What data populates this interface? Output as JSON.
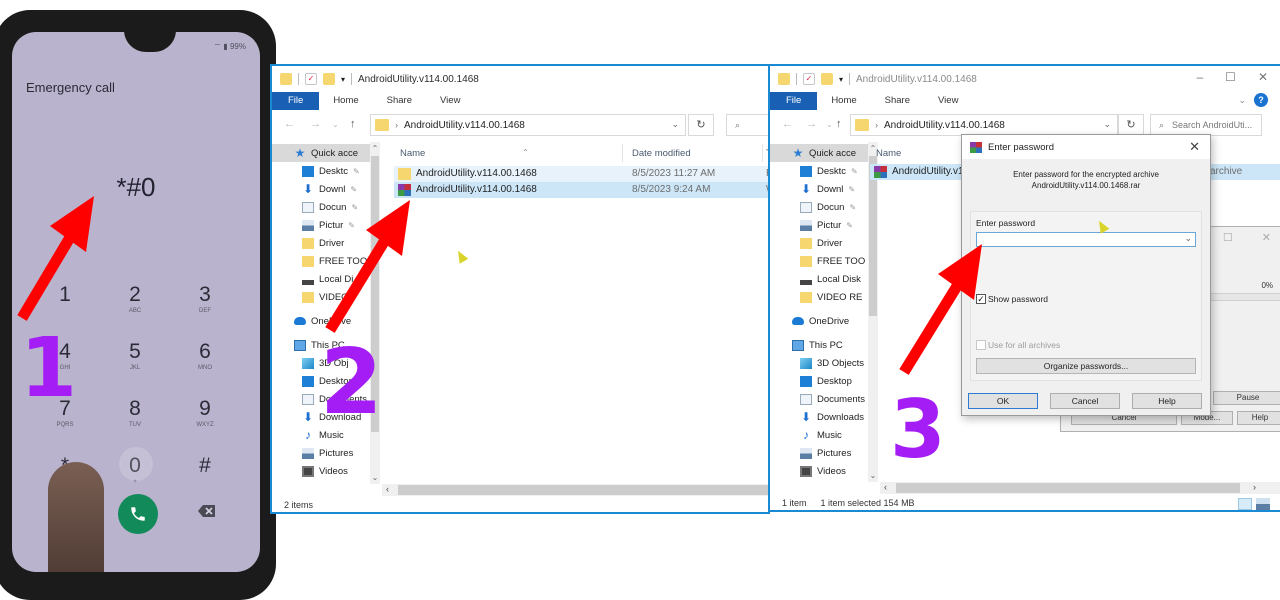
{
  "phone": {
    "status_text": "99%",
    "emergency_label": "Emergency call",
    "dialed_code": "*#0",
    "keys": [
      {
        "num": "1",
        "letters": ""
      },
      {
        "num": "2",
        "letters": "ABC"
      },
      {
        "num": "3",
        "letters": "DEF"
      },
      {
        "num": "4",
        "letters": "GHI"
      },
      {
        "num": "5",
        "letters": "JKL"
      },
      {
        "num": "6",
        "letters": "MNO"
      },
      {
        "num": "7",
        "letters": "PQRS"
      },
      {
        "num": "8",
        "letters": "TUV"
      },
      {
        "num": "9",
        "letters": "WXYZ"
      },
      {
        "num": "*",
        "letters": ""
      },
      {
        "num": "0",
        "letters": "+"
      },
      {
        "num": "#",
        "letters": ""
      }
    ],
    "call_icon": "phone-icon",
    "backspace_icon": "backspace-icon",
    "call_color": "#128a5a"
  },
  "explorer_step2": {
    "title": "AndroidUtility.v114.00.1468",
    "ribbon_tabs": [
      "File",
      "Home",
      "Share",
      "View"
    ],
    "address": "AndroidUtility.v114.00.1468",
    "columns": {
      "name": "Name",
      "date": "Date modified",
      "type": "T"
    },
    "sidebar": [
      {
        "label": "Quick acce",
        "icon": "star",
        "pinned": false
      },
      {
        "label": "Desktc",
        "icon": "desktop",
        "pinned": true
      },
      {
        "label": "Downl",
        "icon": "down",
        "pinned": true
      },
      {
        "label": "Docun",
        "icon": "doc",
        "pinned": true
      },
      {
        "label": "Pictur",
        "icon": "pic",
        "pinned": true
      },
      {
        "label": "Driver",
        "icon": "folder",
        "pinned": false
      },
      {
        "label": "FREE TOO",
        "icon": "folder",
        "pinned": false
      },
      {
        "label": "Local Di",
        "icon": "disk",
        "pinned": false
      },
      {
        "label": "VIDEO",
        "icon": "folder",
        "pinned": false
      },
      {
        "label": "OneDrive",
        "icon": "cloud",
        "pinned": false
      },
      {
        "label": "This PC",
        "icon": "pc",
        "pinned": false
      },
      {
        "label": "3D Obj",
        "icon": "obj",
        "pinned": false
      },
      {
        "label": "Desktop",
        "icon": "desktop",
        "pinned": false
      },
      {
        "label": "Documents",
        "icon": "doc",
        "pinned": false
      },
      {
        "label": "Download",
        "icon": "down",
        "pinned": false
      },
      {
        "label": "Music",
        "icon": "music",
        "pinned": false
      },
      {
        "label": "Pictures",
        "icon": "pic",
        "pinned": false
      },
      {
        "label": "Videos",
        "icon": "video",
        "pinned": false
      }
    ],
    "files": [
      {
        "name": "AndroidUtility.v114.00.1468",
        "date": "8/5/2023 11:27 AM",
        "type": "F",
        "icon": "folder"
      },
      {
        "name": "AndroidUtility.v114.00.1468",
        "date": "8/5/2023 9:24 AM",
        "type": "W",
        "icon": "rar"
      }
    ],
    "status": "2 items"
  },
  "explorer_step3": {
    "title": "AndroidUtility.v114.00.1468",
    "ribbon_tabs": [
      "File",
      "Home",
      "Share",
      "View"
    ],
    "address": "AndroidUtility.v114.00.1468",
    "search_placeholder": "Search AndroidUti...",
    "columns": {
      "name": "Name"
    },
    "sidebar": [
      {
        "label": "Quick acce",
        "icon": "star",
        "pinned": false
      },
      {
        "label": "Desktc",
        "icon": "desktop",
        "pinned": true
      },
      {
        "label": "Downl",
        "icon": "down",
        "pinned": true
      },
      {
        "label": "Docun",
        "icon": "doc",
        "pinned": true
      },
      {
        "label": "Pictur",
        "icon": "pic",
        "pinned": true
      },
      {
        "label": "Driver",
        "icon": "folder",
        "pinned": false
      },
      {
        "label": "FREE TOO",
        "icon": "folder",
        "pinned": false
      },
      {
        "label": "Local Disk",
        "icon": "disk",
        "pinned": false
      },
      {
        "label": "VIDEO RE",
        "icon": "folder",
        "pinned": false
      },
      {
        "label": "OneDrive",
        "icon": "cloud",
        "pinned": false
      },
      {
        "label": "This PC",
        "icon": "pc",
        "pinned": false
      },
      {
        "label": "3D Objects",
        "icon": "obj",
        "pinned": false
      },
      {
        "label": "Desktop",
        "icon": "desktop",
        "pinned": false
      },
      {
        "label": "Documents",
        "icon": "doc",
        "pinned": false
      },
      {
        "label": "Downloads",
        "icon": "down",
        "pinned": false
      },
      {
        "label": "Music",
        "icon": "music",
        "pinned": false
      },
      {
        "label": "Pictures",
        "icon": "pic",
        "pinned": false
      },
      {
        "label": "Videos",
        "icon": "video",
        "pinned": false
      }
    ],
    "files": [
      {
        "name": "AndroidUtility.v114.00.1468.rar",
        "type": "archive",
        "icon": "rar"
      }
    ],
    "status_count": "1 item",
    "status_selected": "1 item selected  154 MB"
  },
  "password_dialog": {
    "title": "Enter password",
    "message_line1": "Enter password for the encrypted archive",
    "message_line2": "AndroidUtility.v114.00.1468.rar",
    "field_label": "Enter password",
    "password_value": "",
    "show_password_label": "Show password",
    "show_password_checked": true,
    "use_for_all_label": "Use for all archives",
    "use_for_all_checked": false,
    "organize_label": "Organize passwords...",
    "ok_label": "OK",
    "cancel_label": "Cancel",
    "help_label": "Help"
  },
  "extract_dialog": {
    "progress_text": "0%",
    "progress": 0,
    "pause_label": "Pause",
    "cancel_label": "Cancel",
    "mode_label": "Mode...",
    "help_label": "Help"
  },
  "annotations": {
    "step1": "1",
    "step2": "2",
    "step3": "3",
    "arrow_color": "#ff0000",
    "number_color": "#a51df5"
  }
}
